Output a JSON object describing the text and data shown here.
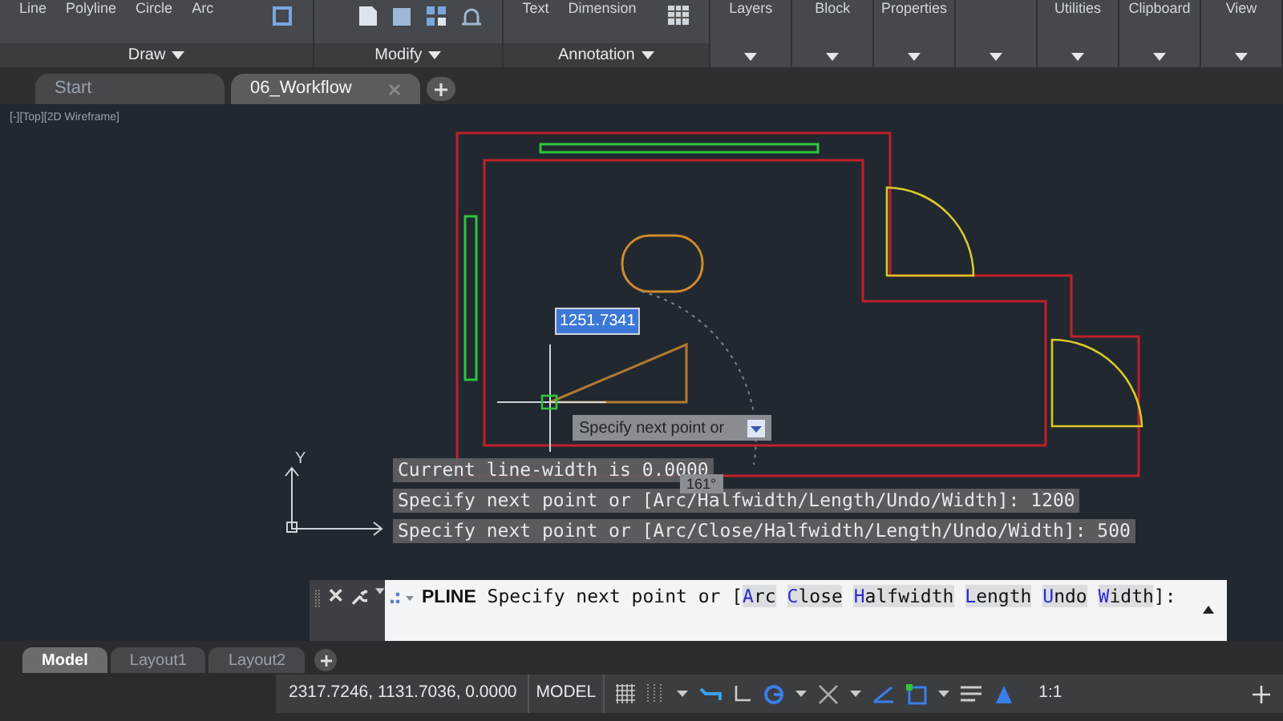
{
  "ribbon": {
    "tools": [
      "Line",
      "Polyline",
      "Circle",
      "Arc",
      "Text",
      "Dimension"
    ],
    "panels": [
      {
        "label": "Draw",
        "expandable": true
      },
      {
        "label": "Modify",
        "expandable": true
      },
      {
        "label": "Annotation",
        "expandable": true
      }
    ],
    "collapsed_panels": [
      {
        "kind": "labeled",
        "label": "Layers"
      },
      {
        "kind": "labeled",
        "label": "Block"
      },
      {
        "kind": "labeled",
        "label": "Properties"
      },
      {
        "kind": "blank"
      },
      {
        "kind": "labeled",
        "label": "Utilities"
      },
      {
        "kind": "labeled",
        "label": "Clipboard"
      },
      {
        "kind": "labeled",
        "label": "View"
      }
    ]
  },
  "file_tabs": [
    {
      "label": "Start",
      "selected": false,
      "closable": false
    },
    {
      "label": "06_Workflow",
      "selected": true,
      "closable": true
    }
  ],
  "viewport_label": "[-][Top][2D Wireframe]",
  "ucs_icon": {
    "y_label": "Y"
  },
  "dynamic_input": {
    "value": "1251.7341",
    "prompt": "Specify next point or",
    "angle": "161°"
  },
  "command_history": [
    "Current line-width is 0.0000",
    "Specify next point or [Arc/Halfwidth/Length/Undo/Width]: 1200",
    "Specify next point or [Arc/Close/Halfwidth/Length/Undo/Width]: 500"
  ],
  "command_line": {
    "command": "PLINE",
    "prompt": "Specify next point or [",
    "options": [
      {
        "hotkey": "A",
        "label": "rc"
      },
      {
        "hotkey": "C",
        "label": "lose"
      },
      {
        "hotkey": "H",
        "label": "alfwidth"
      },
      {
        "hotkey": "L",
        "label": "ength"
      },
      {
        "hotkey": "U",
        "label": "ndo"
      },
      {
        "hotkey": "W",
        "label": "idth"
      }
    ],
    "suffix": "]:"
  },
  "layout_tabs": [
    {
      "label": "Model",
      "selected": true
    },
    {
      "label": "Layout1",
      "selected": false
    },
    {
      "label": "Layout2",
      "selected": false
    }
  ],
  "status_bar": {
    "coordinates": "2317.7246, 1131.7036, 0.0000",
    "space": "MODEL",
    "scale": "1:1"
  }
}
